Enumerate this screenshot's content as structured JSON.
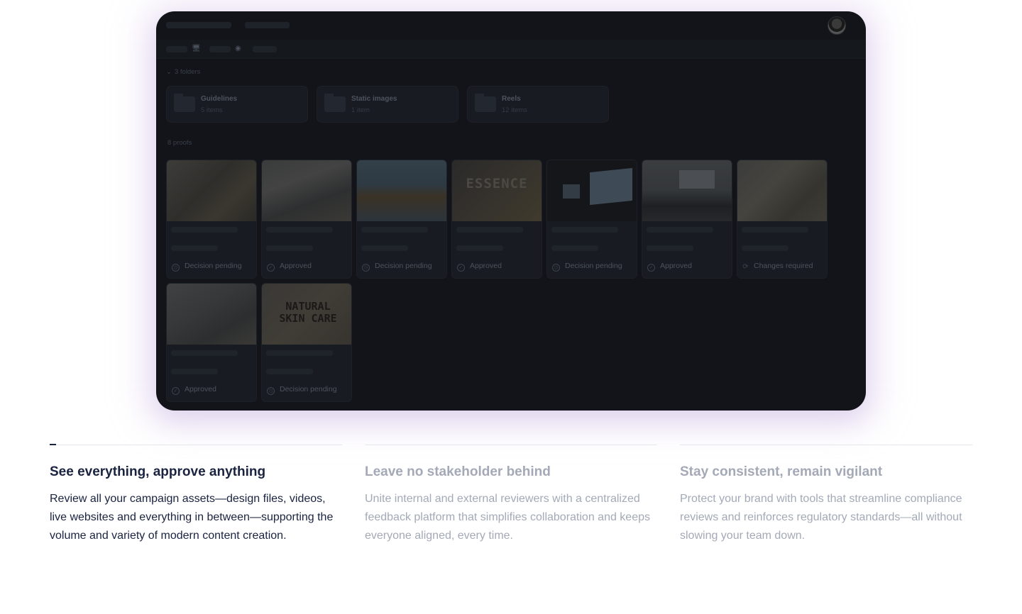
{
  "colors": {
    "app_background": "#121419",
    "active_text": "#1a2340",
    "inactive_text": "#a3a9b6"
  },
  "app": {
    "folders_label": "3 folders",
    "folders": [
      {
        "name": "Guidelines",
        "count": "5 items",
        "icon": "folder-icon"
      },
      {
        "name": "Static images",
        "count": "1 item",
        "icon": "folder-icon"
      },
      {
        "name": "Reels",
        "count": "12 items",
        "icon": "folder-icon"
      }
    ],
    "proofs_label": "8 proofs",
    "proofs": [
      {
        "status": "Decision pending",
        "status_icon": "clock-icon",
        "thumb_text": ""
      },
      {
        "status": "Approved",
        "status_icon": "check-circle-icon",
        "thumb_text": ""
      },
      {
        "status": "Decision pending",
        "status_icon": "clock-icon",
        "thumb_text": ""
      },
      {
        "status": "Approved",
        "status_icon": "check-circle-icon",
        "thumb_text": "ESSENCE"
      },
      {
        "status": "Decision pending",
        "status_icon": "clock-icon",
        "thumb_text": ""
      },
      {
        "status": "Approved",
        "status_icon": "check-circle-icon",
        "thumb_text": ""
      },
      {
        "status": "Changes required",
        "status_icon": "refresh-icon",
        "thumb_text": ""
      },
      {
        "status": "Approved",
        "status_icon": "check-circle-icon",
        "thumb_text": ""
      },
      {
        "status": "Decision pending",
        "status_icon": "clock-icon",
        "thumb_text": "NATURAL SKIN CARE"
      }
    ]
  },
  "features": [
    {
      "title": "See everything, approve anything",
      "body": "Review all your campaign assets—design files, videos, live websites and everything in between—supporting the volume and variety of modern content creation.",
      "active": true
    },
    {
      "title": "Leave no stakeholder behind",
      "body": "Unite internal and external reviewers with a centralized feedback platform that simplifies collaboration and keeps everyone aligned, every time.",
      "active": false
    },
    {
      "title": "Stay consistent, remain vigilant",
      "body": "Protect your brand with tools that streamline compliance reviews and reinforces regulatory standards—all without slowing your team down.",
      "active": false
    }
  ]
}
